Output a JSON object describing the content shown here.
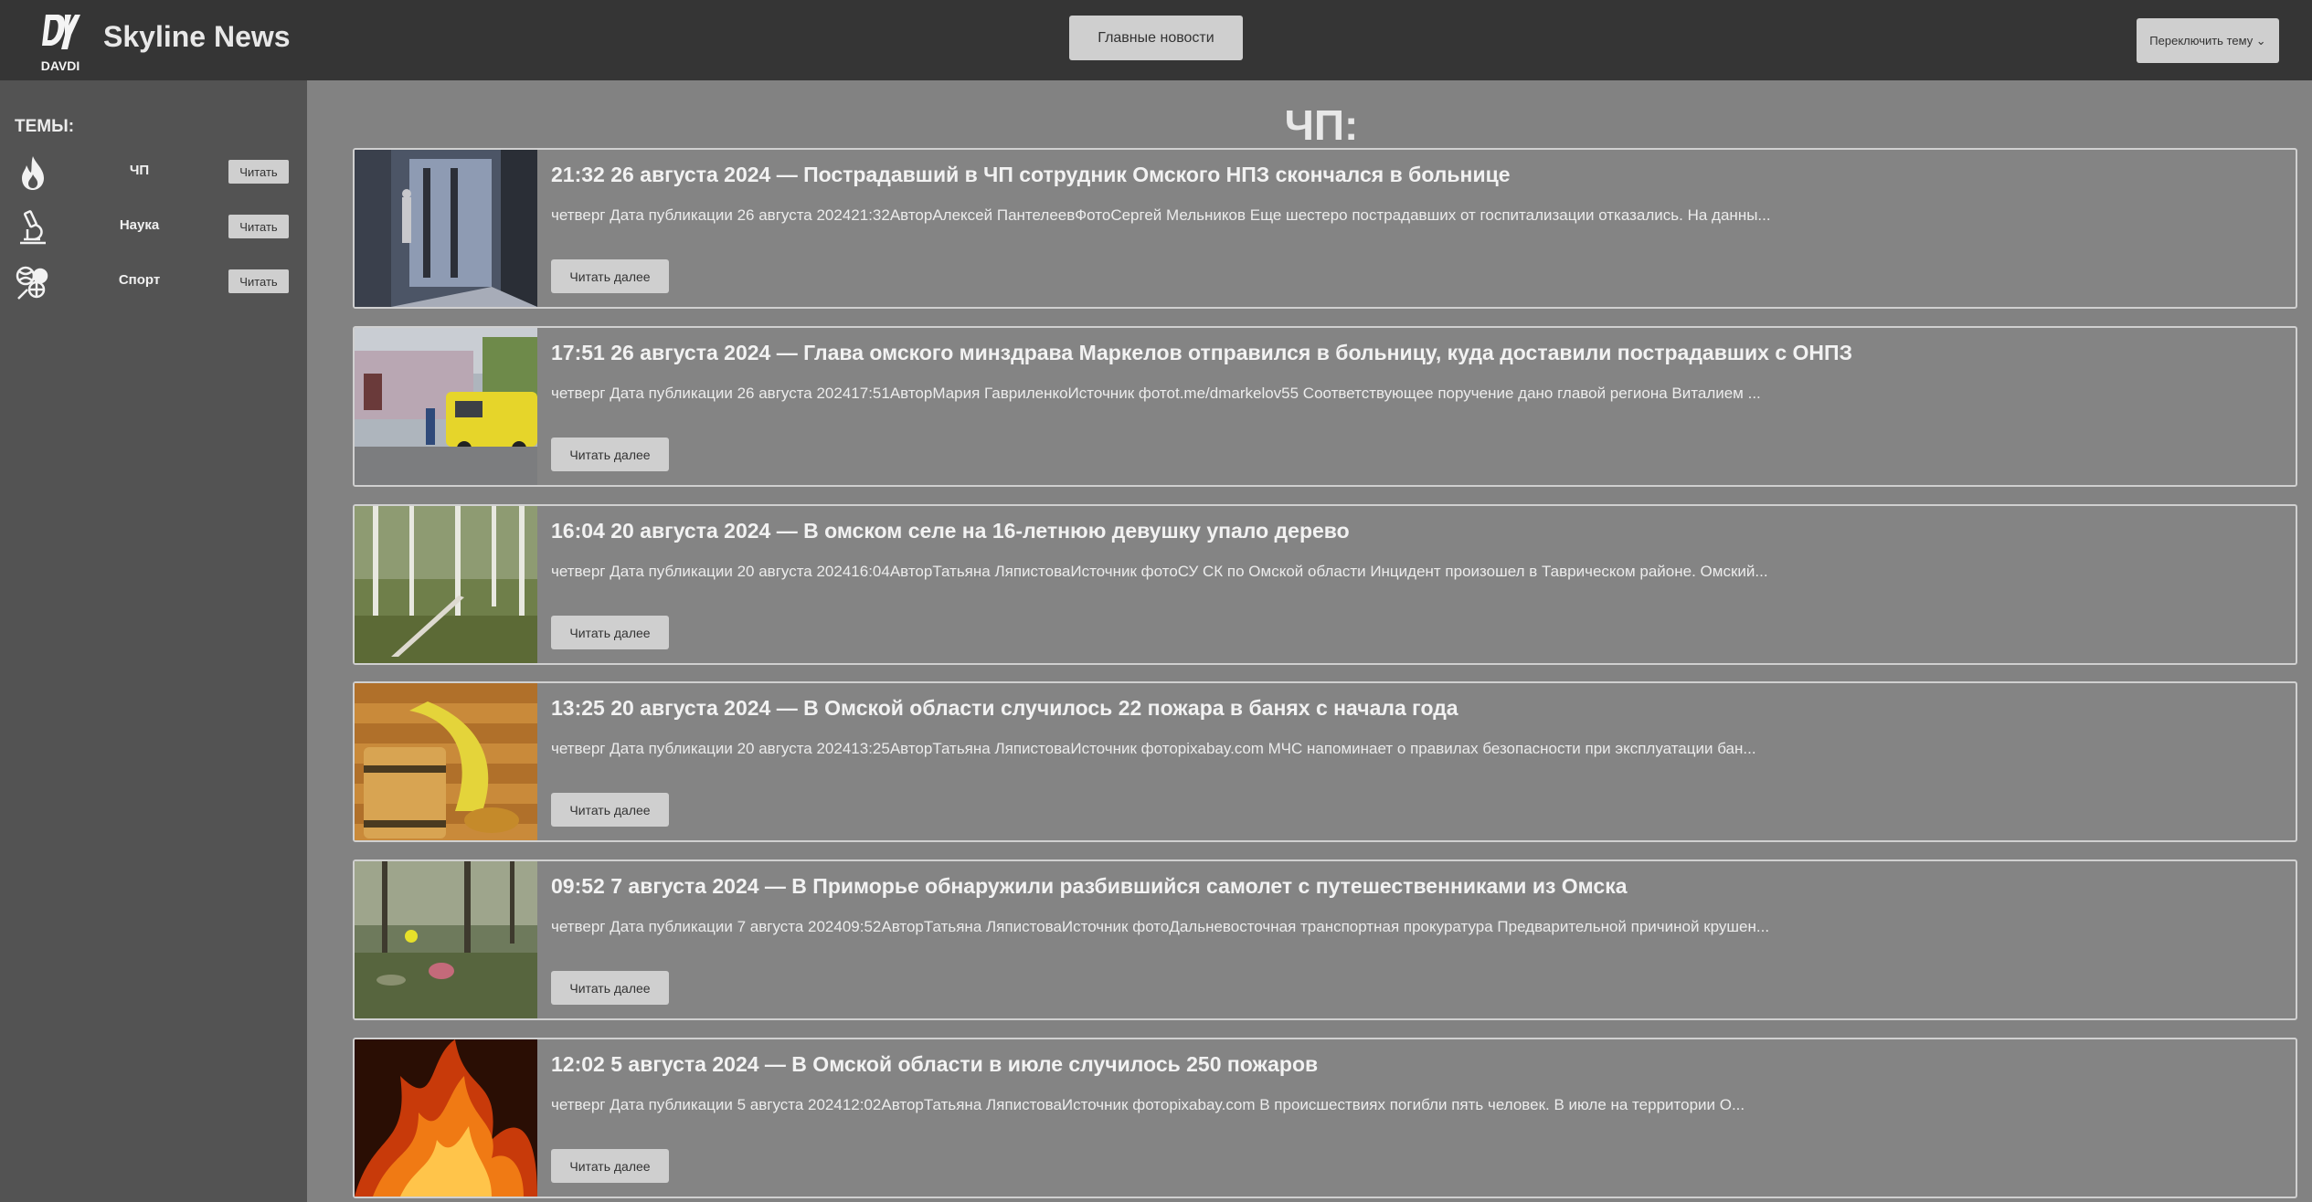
{
  "header": {
    "logo_text": "DAVDI",
    "brand": "Skyline News",
    "main_news_label": "Главные новости",
    "theme_switch_label": "Переключить тему ⌄"
  },
  "sidebar": {
    "title": "ТЕМЫ:",
    "topics": [
      {
        "label": "ЧП",
        "button": "Читать",
        "icon": "fire-icon"
      },
      {
        "label": "Наука",
        "button": "Читать",
        "icon": "microscope-icon"
      },
      {
        "label": "Спорт",
        "button": "Читать",
        "icon": "sports-balls-icon"
      }
    ]
  },
  "main": {
    "page_title": "ЧП:",
    "articles": [
      {
        "title": "21:32 26 августа 2024 — Пострадавший в ЧП сотрудник Омского НПЗ скончался в больнице",
        "desc": "четверг Дата публикации 26 августа 202421:32АвторАлексей ПантелеевФотоСергей Мельников Еще шестеро пострадавших от госпитализации отказались. На данны...",
        "button": "Читать далее",
        "image": "hospital-corridor"
      },
      {
        "title": "17:51 26 августа 2024 — Глава омского минздрава Маркелов отправился в больницу, куда доставили пострадавших с ОНПЗ",
        "desc": "четверг Дата публикации 26 августа 202417:51АвторМария ГавриленкоИсточник фотоt.me/dmarkelov55 Соответствующее поручение дано главой региона Виталием ...",
        "button": "Читать далее",
        "image": "ambulance"
      },
      {
        "title": "16:04 20 августа 2024 — В омском селе на 16-летнюю девушку упало дерево",
        "desc": "четверг Дата публикации 20 августа 202416:04АвторТатьяна ЛяпистоваИсточник фотоСУ СК по Омской области Инцидент произошел в Таврическом районе. Омский...",
        "button": "Читать далее",
        "image": "birch-forest"
      },
      {
        "title": "13:25 20 августа 2024 — В Омской области случилось 22 пожара в банях с начала года",
        "desc": "четверг Дата публикации 20 августа 202413:25АвторТатьяна ЛяпистоваИсточник фотоpixabay.com МЧС напоминает о правилах безопасности при эксплуатации бан...",
        "button": "Читать далее",
        "image": "sauna-bucket"
      },
      {
        "title": "09:52 7 августа 2024 — В Приморье обнаружили разбившийся самолет с путешественниками из Омска",
        "desc": "четверг Дата публикации 7 августа 202409:52АвторТатьяна ЛяпистоваИсточник фотоДальневосточная транспортная прокуратура Предварительной причиной крушен...",
        "button": "Читать далее",
        "image": "plane-wreck"
      },
      {
        "title": "12:02 5 августа 2024 — В Омской области в июле случилось 250 пожаров",
        "desc": "четверг Дата публикации 5 августа 202412:02АвторТатьяна ЛяпистоваИсточник фотоpixabay.com В происшествиях погибли пять человек. В июле на территории О...",
        "button": "Читать далее",
        "image": "fire"
      }
    ]
  }
}
